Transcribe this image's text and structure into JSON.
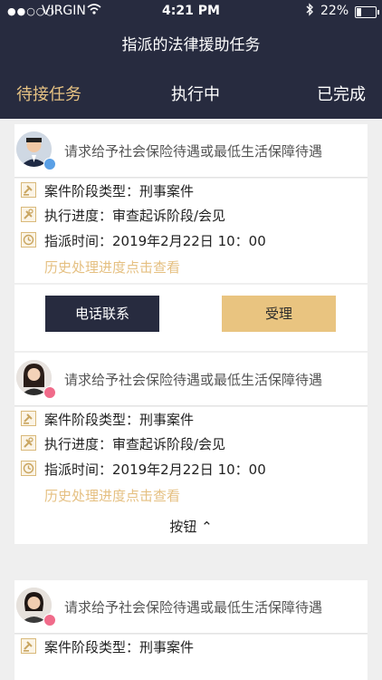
{
  "status_bar": {
    "signal": "●●○○○",
    "carrier": "VIRGIN",
    "time": "4:21 PM",
    "battery": "22%"
  },
  "header": {
    "title": "指派的法律援助任务",
    "tabs": [
      {
        "label": "待接任务",
        "active": true
      },
      {
        "label": "执行中",
        "active": false
      },
      {
        "label": "已完成",
        "active": false
      }
    ]
  },
  "tasks": [
    {
      "request": "请求给予社会保险待遇或最低生活保障待遇",
      "gender": "male",
      "stage_label": "案件阶段类型：刑事案件",
      "progress_label": "执行进度：审查起诉阶段/会见",
      "time_label": "指派时间：2019年2月22日 10：00",
      "history": "历史处理进度点击查看",
      "actions": {
        "call": "电话联系",
        "accept": "受理"
      }
    },
    {
      "request": "请求给予社会保险待遇或最低生活保障待遇",
      "gender": "female",
      "stage_label": "案件阶段类型：刑事案件",
      "progress_label": "执行进度：审查起诉阶段/会见",
      "time_label": "指派时间：2019年2月22日 10：00",
      "history": "历史处理进度点击查看",
      "toggle": "按钮 ⌃"
    },
    {
      "request": "请求给予社会保险待遇或最低生活保障待遇",
      "gender": "female",
      "stage_label": "案件阶段类型：刑事案件"
    }
  ],
  "colors": {
    "header_bg": "#272b3f",
    "accent": "#e6c283",
    "page_bg": "#efefef"
  }
}
